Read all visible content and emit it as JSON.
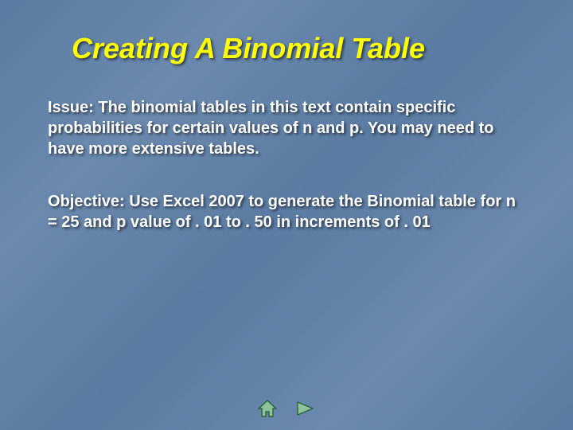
{
  "slide": {
    "title": "Creating A Binomial Table",
    "issue": "Issue:   The binomial tables in this text contain specific probabilities for certain values of n and p. You may need to have more extensive tables.",
    "objective": "Objective: Use Excel 2007 to generate the Binomial table for n = 25 and p value of . 01 to . 50 in increments of . 01"
  },
  "nav": {
    "home_label": "Home",
    "next_label": "Next"
  },
  "colors": {
    "title": "#ffff00",
    "body": "#ffffff",
    "background": "#5e7fa5",
    "icon_stroke": "#1a5c2e",
    "icon_fill": "#7fb88a"
  }
}
